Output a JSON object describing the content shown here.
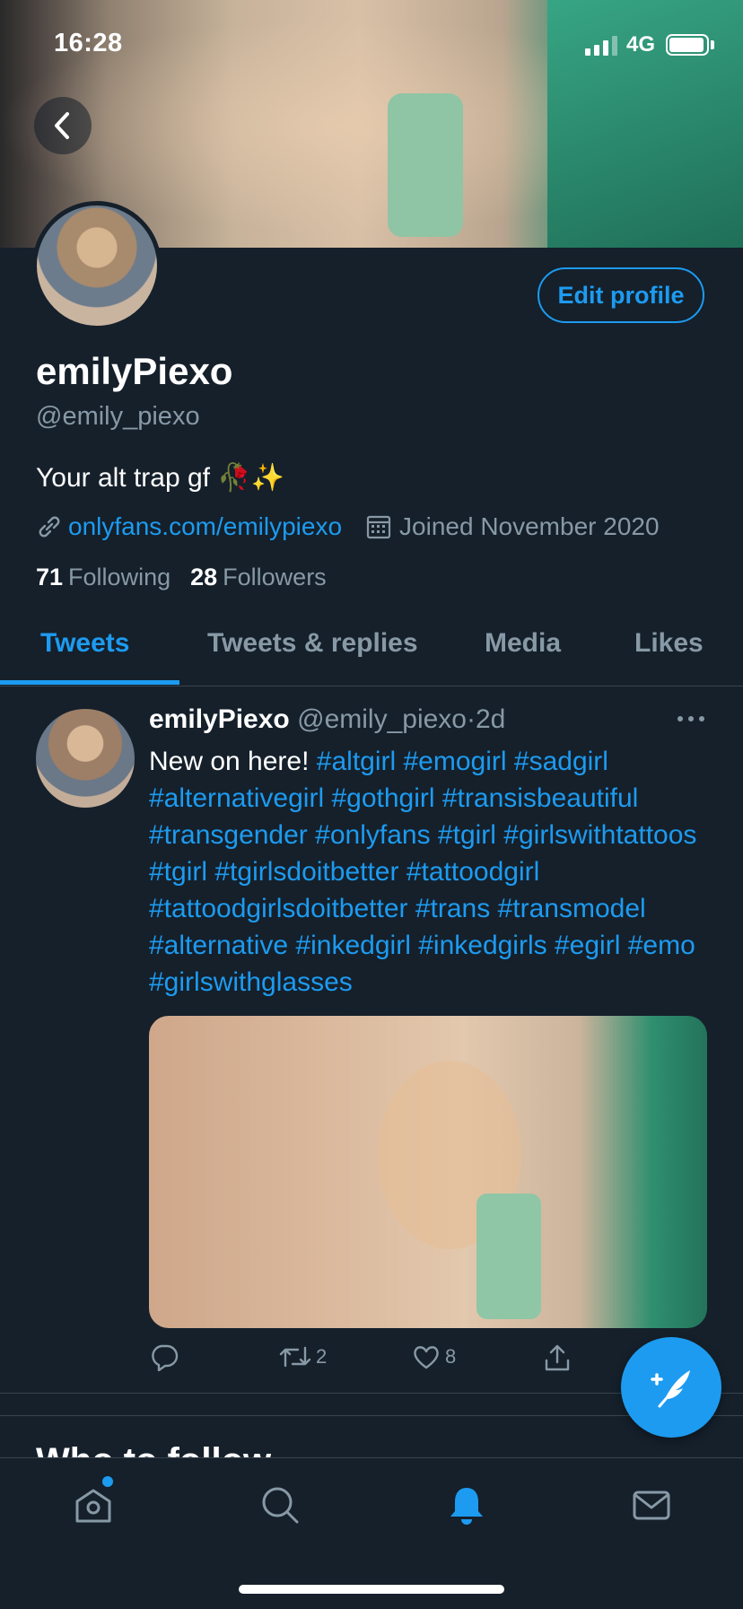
{
  "status_bar": {
    "time": "16:28",
    "network": "4G"
  },
  "profile": {
    "display_name": "emilyPiexo",
    "handle": "@emily_piexo",
    "bio": "Your alt trap gf 🥀✨",
    "link": "onlyfans.com/emilypiexo",
    "joined": "Joined November 2020",
    "following_count": "71",
    "following_label": "Following",
    "followers_count": "28",
    "followers_label": "Followers",
    "edit_profile_label": "Edit profile"
  },
  "tabs": [
    {
      "label": "Tweets",
      "active": true
    },
    {
      "label": "Tweets & replies",
      "active": false
    },
    {
      "label": "Media",
      "active": false
    },
    {
      "label": "Likes",
      "active": false
    }
  ],
  "tweet": {
    "name": "emilyPiexo",
    "handle": "@emily_piexo",
    "separator": "·",
    "time": "2d",
    "text_intro": "New on here!",
    "hashtags": [
      "#altgirl",
      "#emogirl",
      "#sadgirl",
      "#alternativegirl",
      "#gothgirl",
      "#transisbeautiful",
      "#transgender",
      "#onlyfans",
      "#tgirl",
      "#girlswithtattoos",
      "#tgirl",
      "#tgirlsdoitbetter",
      "#tattoodgirl",
      "#tattoodgirlsdoitbetter",
      "#trans",
      "#transmodel",
      "#alternative",
      "#inkedgirl",
      "#inkedgirls",
      "#egirl",
      "#emo",
      "#girlswithglasses"
    ],
    "retweets": "2",
    "likes": "8"
  },
  "section": {
    "who_to_follow": "Who to follow"
  },
  "colors": {
    "background": "#15202b",
    "accent": "#1d9bf0",
    "muted": "#8899a6",
    "border": "#38444d"
  },
  "icons": [
    "back-icon",
    "link-icon",
    "calendar-icon",
    "more-icon",
    "reply-icon",
    "retweet-icon",
    "like-icon",
    "share-icon",
    "compose-icon",
    "home-icon",
    "search-icon",
    "notifications-icon",
    "messages-icon"
  ]
}
